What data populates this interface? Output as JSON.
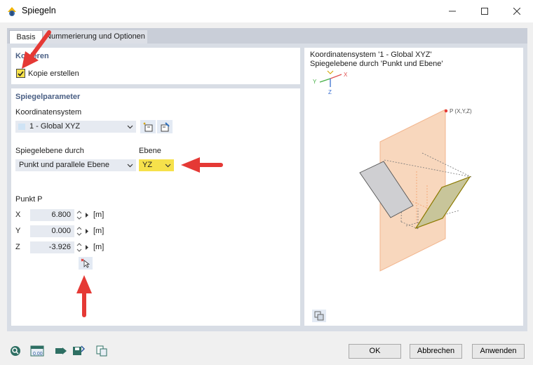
{
  "window": {
    "title": "Spiegeln",
    "controls": [
      "minimize-icon",
      "maximize-icon",
      "close-icon"
    ]
  },
  "tabs": [
    {
      "label": "Basis",
      "active": true
    },
    {
      "label": "Nummerierung und Optionen",
      "active": false
    }
  ],
  "copy_section": {
    "title": "Kopieren",
    "checkbox_label": "Kopie erstellen",
    "checked": true
  },
  "mirror_params": {
    "title": "Spiegelparameter",
    "coord_system_label": "Koordinatensystem",
    "coord_system_value": "1 - Global XYZ",
    "plane_by_label": "Spiegelebene durch",
    "plane_by_value": "Punkt und parallele Ebene",
    "plane_label": "Ebene",
    "plane_value": "YZ",
    "point_label": "Punkt P",
    "coords": [
      {
        "axis": "X",
        "value": "6.800",
        "unit": "[m]"
      },
      {
        "axis": "Y",
        "value": "0.000",
        "unit": "[m]"
      },
      {
        "axis": "Z",
        "value": "-3.926",
        "unit": "[m]"
      }
    ]
  },
  "preview": {
    "line1": "Koordinatensystem '1 - Global XYZ'",
    "line2": "Spiegelebene durch 'Punkt und Ebene'",
    "point_label": "P (X,Y,Z)",
    "axis_labels": [
      "X",
      "Y",
      "Z"
    ]
  },
  "buttons": {
    "ok": "OK",
    "cancel": "Abbrechen",
    "apply": "Anwenden"
  },
  "bottom_tools": [
    "search-icon",
    "units-icon",
    "forward-icon",
    "save-icon",
    "copy-icon"
  ],
  "colors": {
    "accent": "#4a5f84",
    "highlight": "#f6e14b",
    "arrow": "#e53935",
    "plane": "#f8d7bd",
    "grey_shape": "#cfcfd2",
    "yellow_shape": "#c8c59a"
  }
}
